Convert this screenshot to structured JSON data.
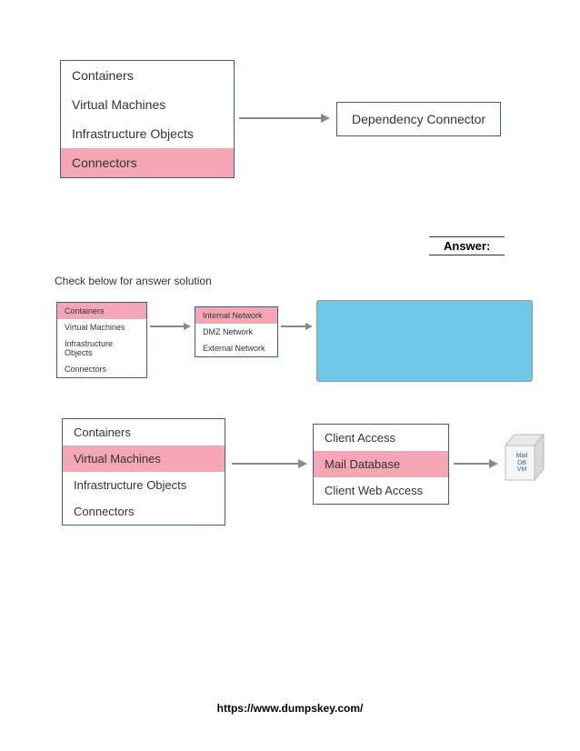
{
  "section1": {
    "list": [
      "Containers",
      "Virtual Machines",
      "Infrastructure Objects",
      "Connectors"
    ],
    "highlighted_index": 3,
    "target": "Dependency Connector"
  },
  "answer_label": "Answer:",
  "instruction": "Check below for answer solution",
  "section2": {
    "list1": [
      "Containers",
      "Virtual Machines",
      "Infrastructure Objects",
      "Connectors"
    ],
    "list1_highlighted": 0,
    "list2": [
      "Internal Network",
      "DMZ Network",
      "External Network"
    ],
    "list2_highlighted": 0
  },
  "section3": {
    "list1": [
      "Containers",
      "Virtual Machines",
      "Infrastructure Objects",
      "Connectors"
    ],
    "list1_highlighted": 1,
    "list2": [
      "Client Access",
      "Mail Database",
      "Client Web Access"
    ],
    "list2_highlighted": 1,
    "cube_label": "Mail\nDB\nVM"
  },
  "footer": "https://www.dumpskey.com/"
}
